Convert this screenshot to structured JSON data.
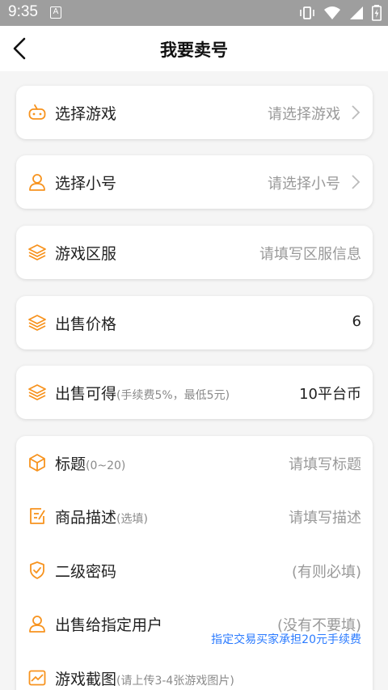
{
  "status_bar": {
    "time": "9:35",
    "notification_letter": "A"
  },
  "nav": {
    "title": "我要卖号"
  },
  "form": {
    "game": {
      "label": "选择游戏",
      "value": "请选择游戏"
    },
    "account": {
      "label": "选择小号",
      "value": "请选择小号"
    },
    "server": {
      "label": "游戏区服",
      "value": "请填写区服信息"
    },
    "price": {
      "label": "出售价格",
      "value": "6"
    },
    "earn": {
      "label": "出售可得",
      "sub": "(手续费5%，最低5元)",
      "value": "10平台币"
    },
    "title_field": {
      "label": "标题",
      "sub": "(0~20)",
      "value": "请填写标题"
    },
    "description": {
      "label": "商品描述",
      "sub": "(选填)",
      "value": "请填写描述"
    },
    "password": {
      "label": "二级密码",
      "value": "(有则必填)"
    },
    "buyer": {
      "label": "出售给指定用户",
      "value": "(没有不要填)",
      "note": "指定交易买家承担20元手续费"
    },
    "screenshots": {
      "label": "游戏截图",
      "sub": "(请上传3-4张游戏图片)"
    }
  },
  "colors": {
    "accent": "#f7931e",
    "link": "#2b7bff",
    "status_bar": "#9e9e9e"
  },
  "icons": [
    "gamepad-icon",
    "user-icon",
    "layers-icon",
    "box-icon",
    "edit-icon",
    "shield-icon",
    "image-icon",
    "chevron-right-icon",
    "back-arrow-icon"
  ]
}
